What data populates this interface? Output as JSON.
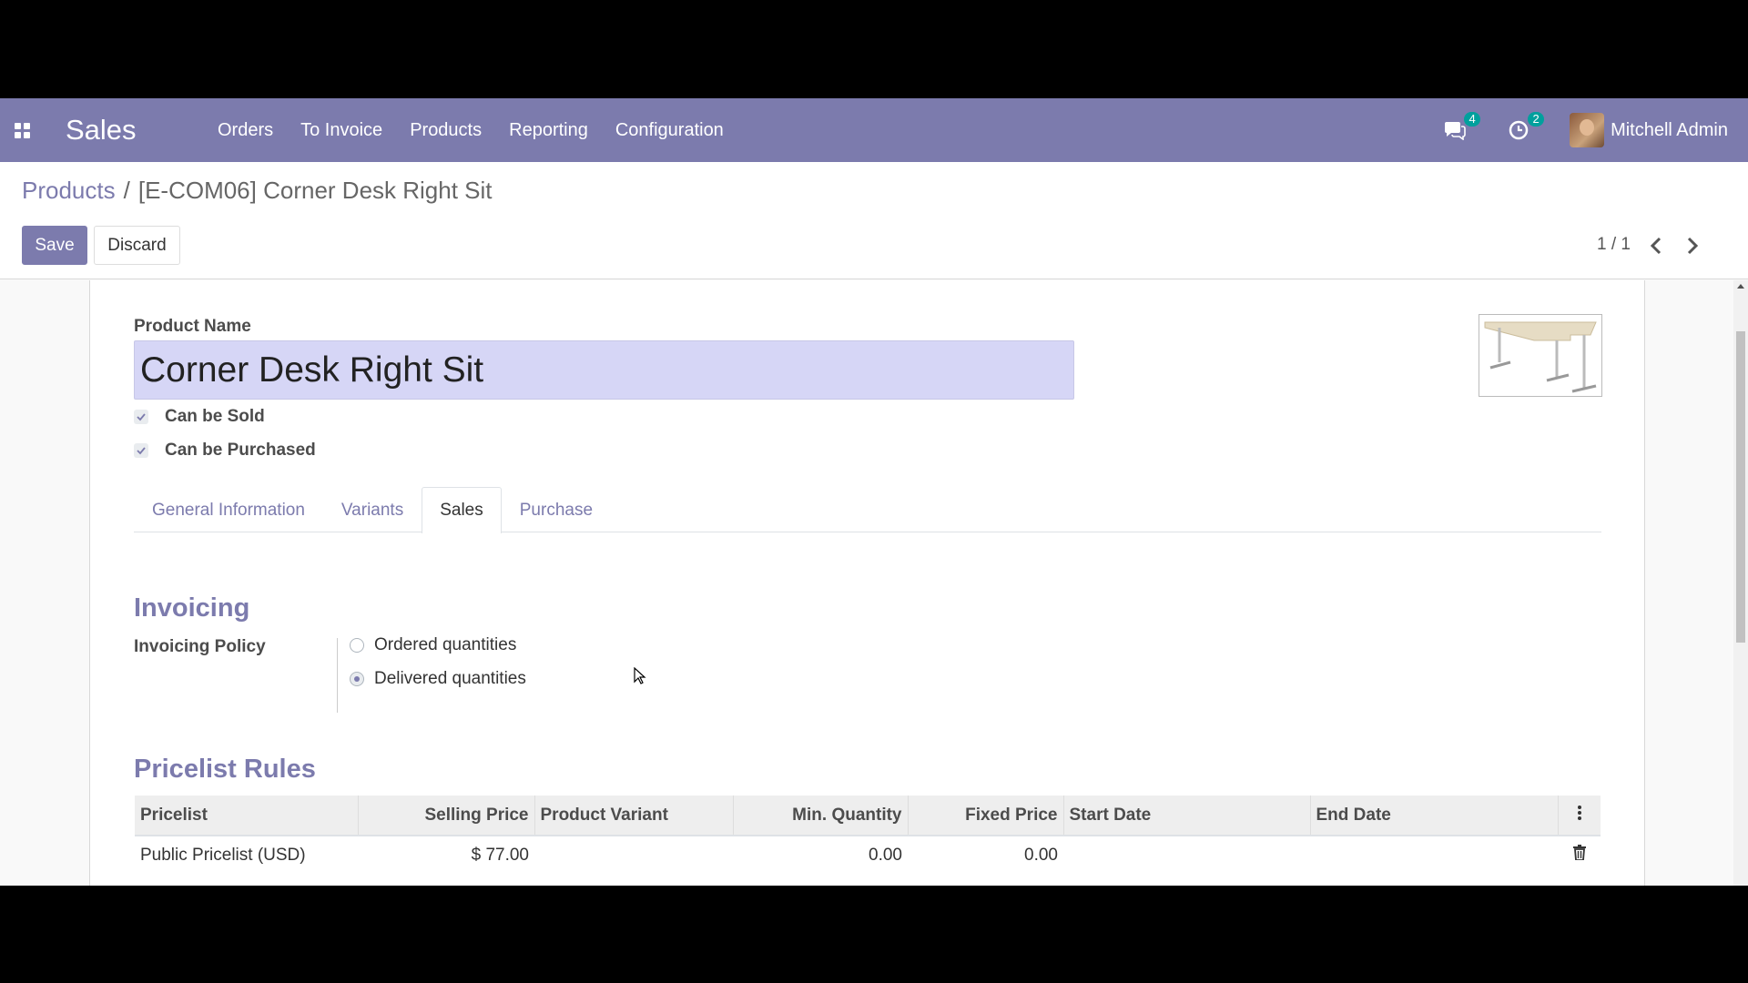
{
  "navbar": {
    "app_name": "Sales",
    "menu": [
      "Orders",
      "To Invoice",
      "Products",
      "Reporting",
      "Configuration"
    ],
    "messages_count": "4",
    "activities_count": "2",
    "user_name": "Mitchell Admin",
    "color": "#7c7bad"
  },
  "breadcrumb": {
    "parent": "Products",
    "separator": "/",
    "current": "[E-COM06] Corner Desk Right Sit"
  },
  "actions": {
    "save": "Save",
    "discard": "Discard"
  },
  "pager": {
    "value": "1 / 1"
  },
  "form": {
    "name_label": "Product Name",
    "name_value": "Corner Desk Right Sit",
    "can_be_sold": {
      "label": "Can be Sold",
      "checked": true
    },
    "can_be_purchased": {
      "label": "Can be Purchased",
      "checked": true
    },
    "tabs": [
      "General Information",
      "Variants",
      "Sales",
      "Purchase"
    ],
    "active_tab": "Sales",
    "invoicing": {
      "title": "Invoicing",
      "policy_label": "Invoicing Policy",
      "options": [
        "Ordered quantities",
        "Delivered quantities"
      ],
      "selected": "Delivered quantities"
    },
    "pricelist": {
      "title": "Pricelist Rules",
      "columns": [
        "Pricelist",
        "Selling Price",
        "Product Variant",
        "Min. Quantity",
        "Fixed Price",
        "Start Date",
        "End Date"
      ],
      "rows": [
        [
          "Public Pricelist (USD)",
          "$ 77.00",
          "",
          "0.00",
          "0.00",
          "",
          ""
        ]
      ]
    }
  }
}
